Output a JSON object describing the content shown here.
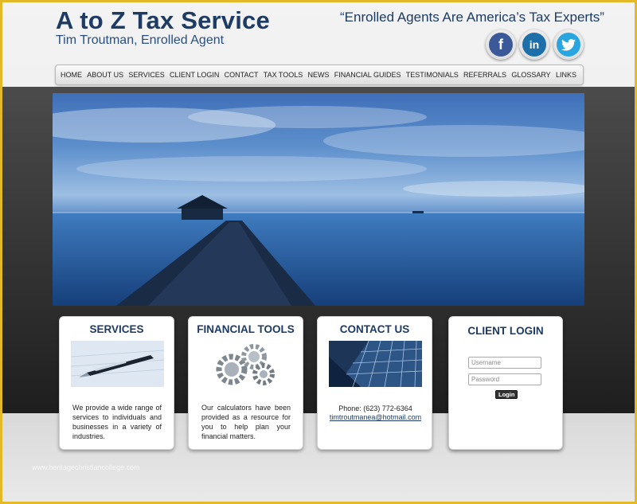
{
  "header": {
    "title": "A to Z Tax Service",
    "subtitle": "Tim Troutman, Enrolled Agent",
    "tagline": "“Enrolled Agents Are America’s Tax Experts”"
  },
  "social": [
    {
      "name": "facebook",
      "glyph": "f",
      "color": "#3b5998"
    },
    {
      "name": "linkedin",
      "glyph": "in",
      "color": "#1c6fa8"
    },
    {
      "name": "twitter",
      "glyph": "🐦",
      "color": "#29a5e0"
    }
  ],
  "nav": {
    "items": [
      "HOME",
      "ABOUT US",
      "SERVICES",
      "CLIENT LOGIN",
      "CONTACT",
      "TAX TOOLS",
      "NEWS",
      "FINANCIAL GUIDES",
      "TESTIMONIALS",
      "REFERRALS",
      "GLOSSARY",
      "LINKS"
    ]
  },
  "cards": {
    "services": {
      "title": "SERVICES",
      "text": "We provide a wide range of services to individuals and businesses in a variety of industries."
    },
    "tools": {
      "title": "FINANCIAL TOOLS",
      "text": "Our calculators have been provided as a resource for you to help plan your financial matters."
    },
    "contact": {
      "title": "CONTACT US",
      "phone": "Phone: (623) 772-6364",
      "email": "timtroutmanea@hotmail.com"
    }
  },
  "login": {
    "title": "CLIENT LOGIN",
    "username_placeholder": "Username",
    "password_placeholder": "Password",
    "button_label": "Login"
  },
  "watermark": "www.heritagechristiancollege.com"
}
